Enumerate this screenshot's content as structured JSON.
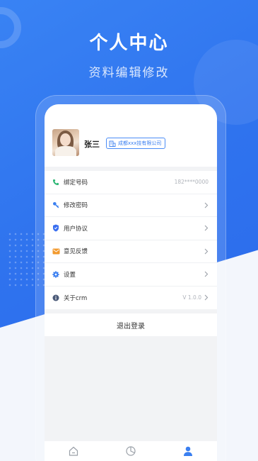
{
  "hero": {
    "title": "个人中心",
    "subtitle": "资料编辑修改"
  },
  "profile": {
    "name": "张三",
    "company": "成都xxx技有限公司",
    "avatar_icon": "user-photo"
  },
  "menu": [
    {
      "label": "绑定号码",
      "value": "182****0000",
      "icon": "phone-icon",
      "icon_color": "#2bb673",
      "chevron": false
    },
    {
      "label": "修改密码",
      "value": "",
      "icon": "key-icon",
      "icon_color": "#3a7ff0",
      "chevron": true
    },
    {
      "label": "用户协议",
      "value": "",
      "icon": "shield-icon",
      "icon_color": "#3a6ff0",
      "chevron": true
    },
    {
      "label": "意见反馈",
      "value": "",
      "icon": "mail-icon",
      "icon_color": "#f29a2e",
      "chevron": true
    },
    {
      "label": "设置",
      "value": "",
      "icon": "gear-icon",
      "icon_color": "#3a7ff0",
      "chevron": true
    },
    {
      "label": "关于crm",
      "value": "V 1.0.0",
      "icon": "info-icon",
      "icon_color": "#4b5a78",
      "chevron": true
    }
  ],
  "logout_label": "退出登录",
  "tabbar": {
    "tabs": [
      {
        "label": "首页",
        "icon": "home-icon",
        "active": false
      },
      {
        "label": "统计",
        "icon": "chart-icon",
        "active": false
      },
      {
        "label": "我的",
        "icon": "user-icon",
        "active": true
      }
    ]
  },
  "colors": {
    "primary": "#2f73ee",
    "accent": "#3a7ff0"
  }
}
